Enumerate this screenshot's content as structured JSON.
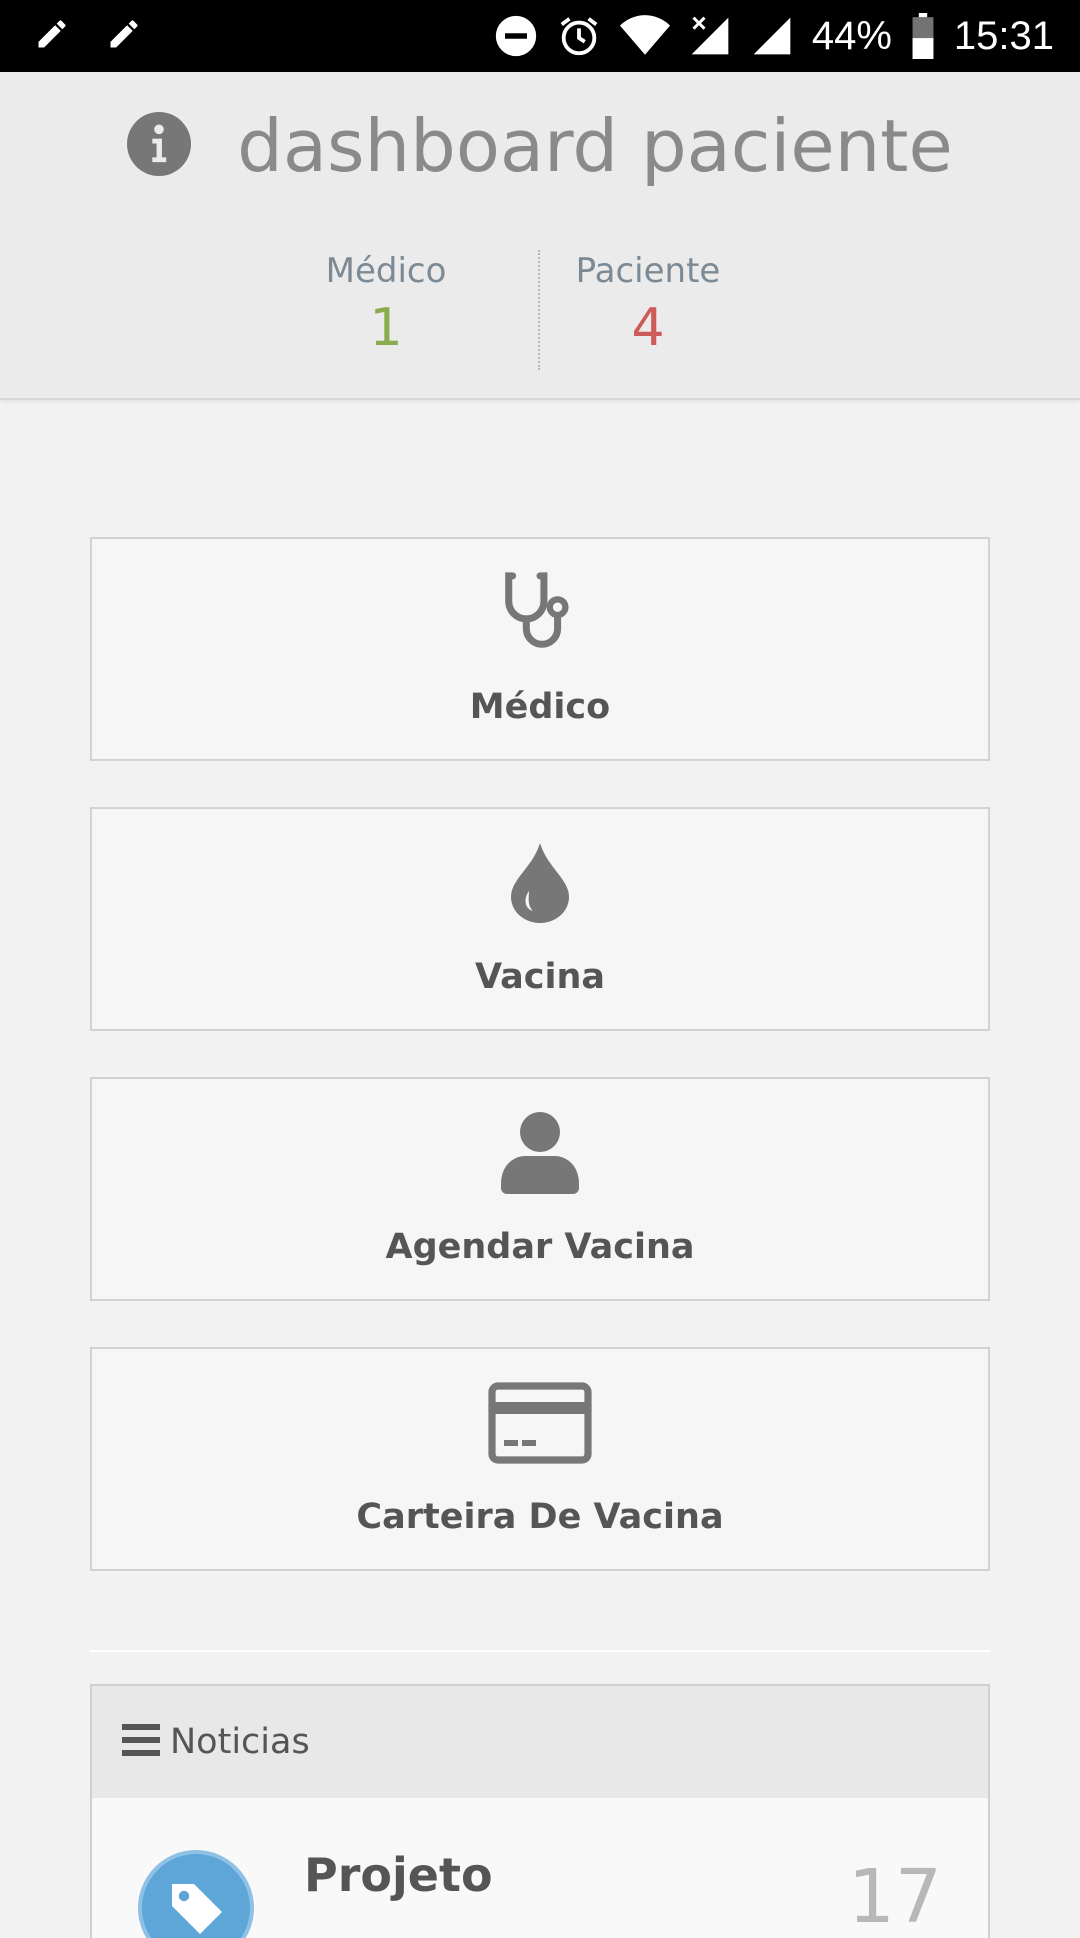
{
  "status_bar": {
    "battery": "44%",
    "time": "15:31",
    "left_icons": [
      "pencil-icon",
      "pencil-icon"
    ],
    "right_icons": [
      "do-not-disturb-icon",
      "alarm-icon",
      "wifi-icon",
      "no-signal-icon",
      "signal-icon",
      "battery-icon"
    ]
  },
  "header": {
    "title": "dashboard paciente",
    "icon": "info-icon",
    "stats": [
      {
        "label": "Médico",
        "value": "1",
        "color": "#8aab4e"
      },
      {
        "label": "Paciente",
        "value": "4",
        "color": "#cf5a5a"
      }
    ]
  },
  "tiles": [
    {
      "label": "Médico",
      "icon": "stethoscope-icon"
    },
    {
      "label": "Vacina",
      "icon": "drop-icon"
    },
    {
      "label": "Agendar Vacina",
      "icon": "user-icon"
    },
    {
      "label": "Carteira De Vacina",
      "icon": "credit-card-icon"
    }
  ],
  "news": {
    "header_label": "Noticias",
    "header_icon": "menu-icon",
    "items": [
      {
        "title": "Projeto",
        "count": "17",
        "icon": "tag-icon"
      }
    ]
  },
  "colors": {
    "accent_green": "#8aab4e",
    "accent_red": "#cf5a5a",
    "icon_gray": "#777777"
  }
}
